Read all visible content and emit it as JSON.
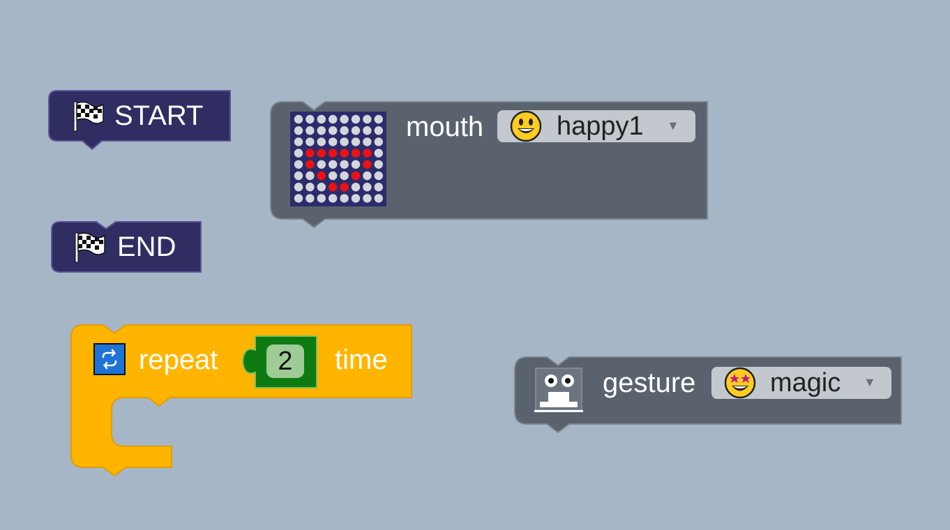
{
  "blocks": {
    "start": {
      "label": "START",
      "icon": "checkered-flag-icon",
      "color": "#2f2d62"
    },
    "end": {
      "label": "END",
      "icon": "checkered-flag-icon",
      "color": "#2f2d62"
    },
    "mouth": {
      "label": "mouth",
      "color": "#5a636d",
      "dropdown_value": "happy1",
      "dropdown_icon": "smiling-face-icon",
      "preview_icon": "led-matrix-icon"
    },
    "repeat": {
      "label": "repeat",
      "suffix": "time",
      "count": "2",
      "icon": "loop-arrows-icon",
      "color": "#ffb500",
      "count_color": "#0e7a12"
    },
    "gesture": {
      "label": "gesture",
      "color": "#5a636d",
      "dropdown_value": "magic",
      "dropdown_icon": "star-struck-face-icon",
      "preview_icon": "robot-face-icon"
    }
  }
}
